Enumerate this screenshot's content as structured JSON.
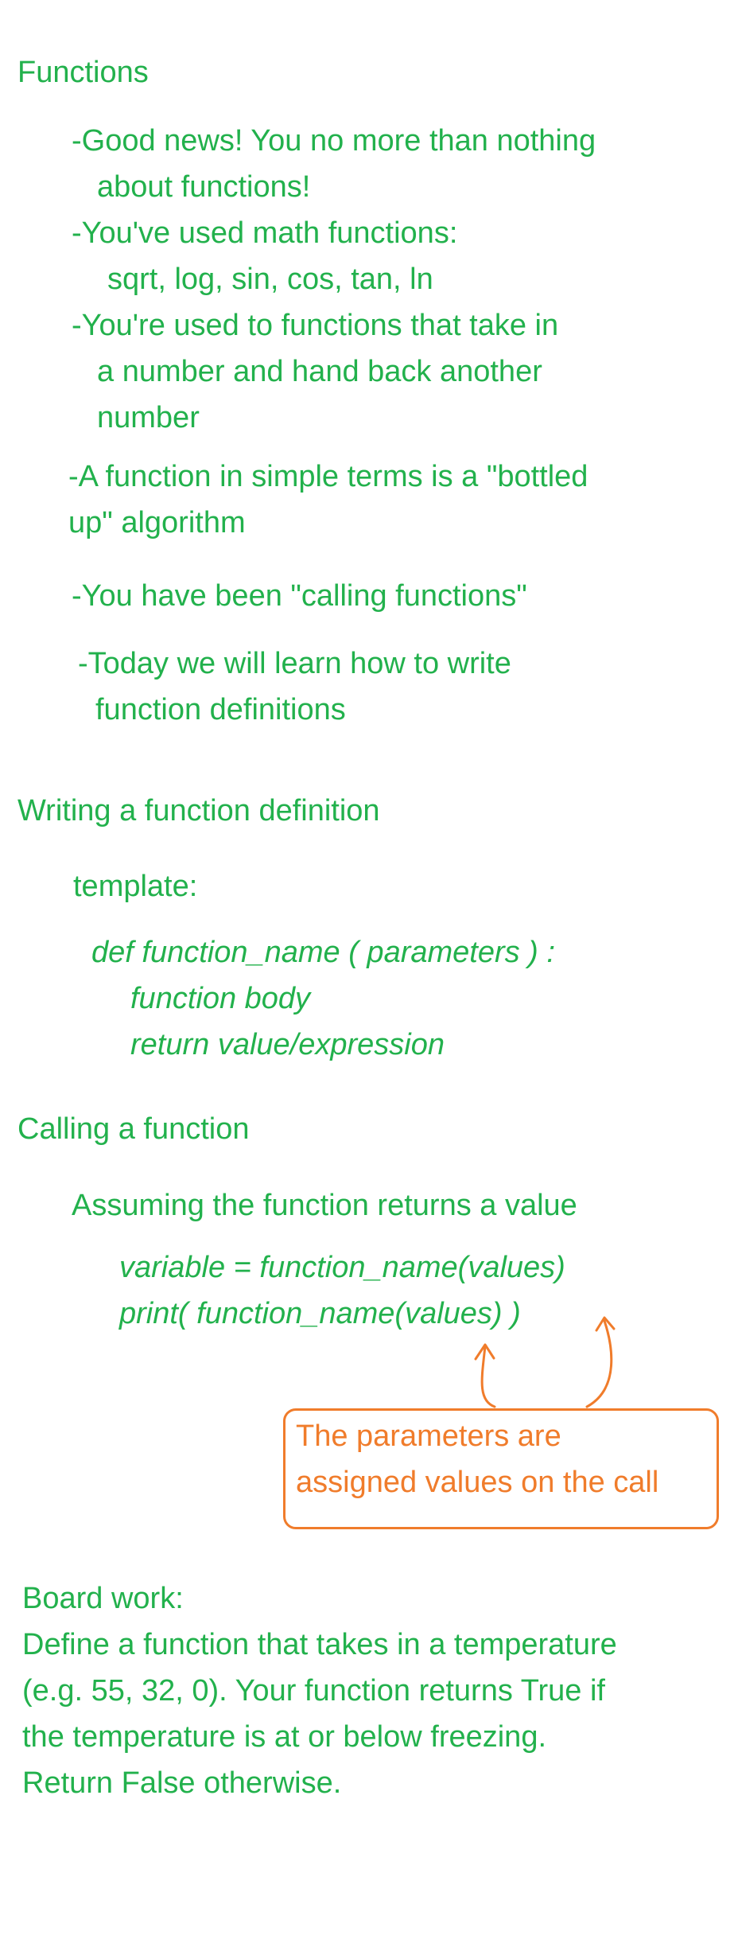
{
  "sections": {
    "functions": {
      "heading": "Functions",
      "bullets": [
        "-Good news! You no more than nothing",
        "about functions!",
        "-You've used math functions:",
        "sqrt, log, sin, cos, tan, ln",
        "-You're used to functions that take in",
        "a number and hand back another",
        "number",
        "-A function in simple terms is a \"bottled",
        "up\" algorithm",
        "-You have been \"calling functions\"",
        "-Today we will learn how to write",
        "function definitions"
      ]
    },
    "writing": {
      "heading": "Writing a function definition",
      "template_label": "template:",
      "code": [
        "def function_name ( parameters ) :",
        "function body",
        "return value/expression"
      ]
    },
    "calling": {
      "heading": "Calling a function",
      "intro": "Assuming the function returns a value",
      "code": [
        "variable = function_name(values)",
        "print( function_name(values) )"
      ],
      "callout": [
        "The parameters are",
        "assigned values on the call"
      ]
    },
    "board": {
      "lines": [
        "Board work:",
        "Define a function that takes in a temperature",
        "(e.g. 55, 32, 0). Your function returns True if",
        "the temperature is at or below freezing.",
        "Return False otherwise."
      ]
    }
  },
  "colors": {
    "ink_green": "#22b14c",
    "ink_orange": "#f07c2b",
    "background": "#ffffff"
  }
}
